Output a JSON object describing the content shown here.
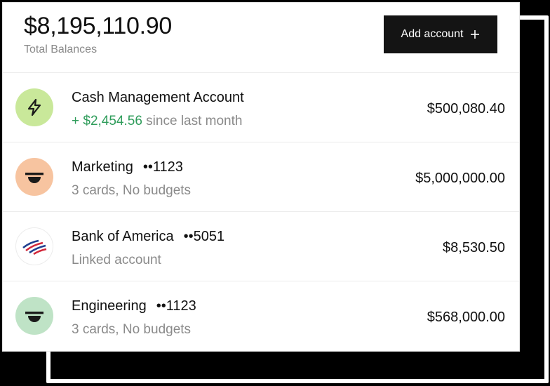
{
  "summary": {
    "total_amount": "$8,195,110.90",
    "total_label": "Total Balances"
  },
  "toolbar": {
    "add_account_label": "Add account",
    "add_icon": "plus-icon"
  },
  "accounts": [
    {
      "name": "Cash Management Account",
      "mask": "",
      "subtitle_gain": "+ $2,454.56",
      "subtitle": " since last month",
      "balance": "$500,080.40",
      "icon": "lightning-bolt-icon",
      "avatar_color": "#c9e89a"
    },
    {
      "name": "Marketing",
      "mask": "••1123",
      "subtitle_gain": "",
      "subtitle": "3 cards, No budgets",
      "balance": "$5,000,000.00",
      "icon": "smiley-icon",
      "avatar_color": "#f7c4a0"
    },
    {
      "name": "Bank of America",
      "mask": "••5051",
      "subtitle_gain": "",
      "subtitle": "Linked account",
      "balance": "$8,530.50",
      "icon": "bank-of-america-logo-icon",
      "avatar_color": "#ffffff"
    },
    {
      "name": "Engineering",
      "mask": "••1123",
      "subtitle_gain": "",
      "subtitle": "3 cards, No budgets",
      "balance": "$568,000.00",
      "icon": "smiley-icon",
      "avatar_color": "#bfe3c6"
    }
  ],
  "colors": {
    "gain": "#2e9c5a",
    "button_bg": "#141414",
    "muted_text": "#8a8a8a"
  }
}
